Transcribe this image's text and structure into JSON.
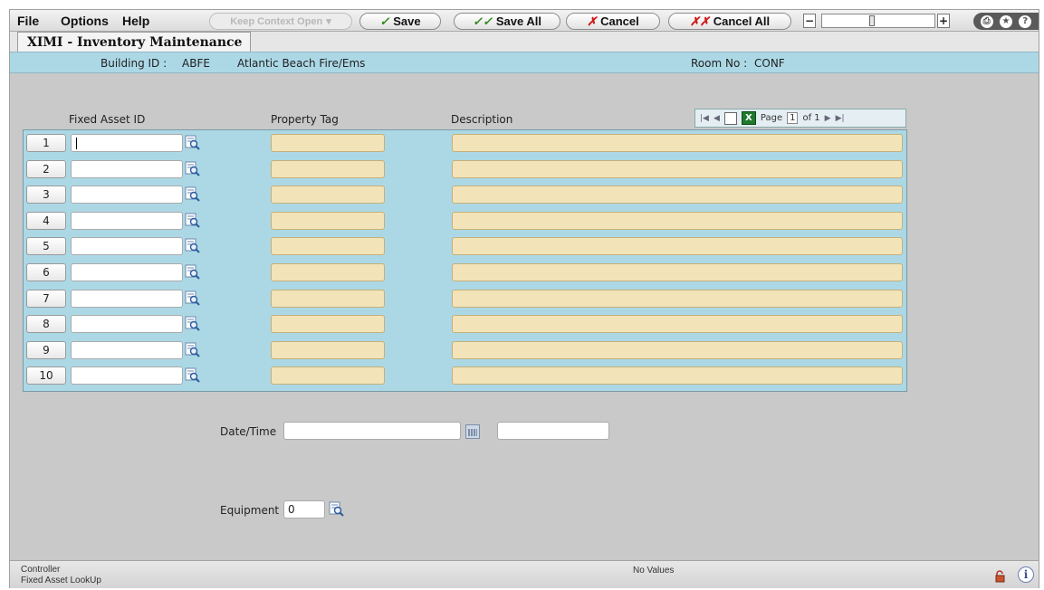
{
  "menu": {
    "file": "File",
    "options": "Options",
    "help": "Help"
  },
  "toolbar": {
    "keep_context": "Keep Context Open",
    "save": "Save",
    "save_all": "Save All",
    "cancel": "Cancel",
    "cancel_all": "Cancel All",
    "zoom_minus": "−",
    "zoom_plus": "+",
    "zoom_level": 0.45
  },
  "tab": {
    "title": "XIMI - Inventory Maintenance"
  },
  "info": {
    "building_label": "Building ID :",
    "building_id": "ABFE",
    "building_name": "Atlantic Beach Fire/Ems",
    "room_label": "Room No :",
    "room_no": "CONF"
  },
  "grid": {
    "columns": [
      "Fixed Asset ID",
      "Property Tag",
      "Description"
    ],
    "pager": {
      "page_label": "Page",
      "page": "1",
      "of_label": "of 1"
    },
    "rows": [
      "1",
      "2",
      "3",
      "4",
      "5",
      "6",
      "7",
      "8",
      "9",
      "10"
    ]
  },
  "form": {
    "datetime_label": "Date/Time",
    "equipment_label": "Equipment",
    "equipment_value": "0"
  },
  "status": {
    "line1": "Controller",
    "line2": "Fixed Asset LookUp",
    "center": "No Values"
  }
}
